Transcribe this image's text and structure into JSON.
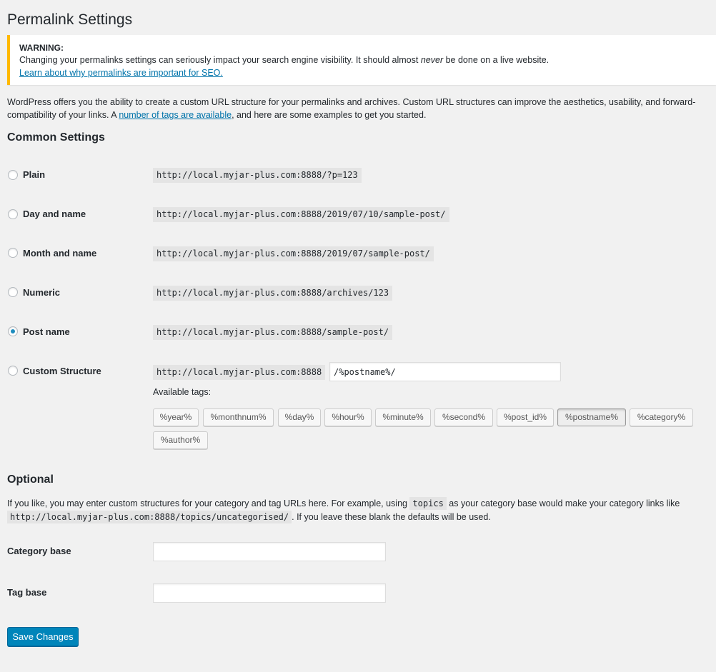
{
  "page_title": "Permalink Settings",
  "notice": {
    "heading": "WARNING:",
    "body_before": "Changing your permalinks settings can seriously impact your search engine visibility. It should almost ",
    "body_em": "never",
    "body_after": " be done on a live website.",
    "link": "Learn about why permalinks are important for SEO."
  },
  "intro": {
    "before": "WordPress offers you the ability to create a custom URL structure for your permalinks and archives. Custom URL structures can improve the aesthetics, usability, and forward-compatibility of your links. A ",
    "link": "number of tags are available",
    "after": ", and here are some examples to get you started."
  },
  "common": {
    "heading": "Common Settings",
    "options": [
      {
        "label": "Plain",
        "example": "http://local.myjar-plus.com:8888/?p=123",
        "checked": false
      },
      {
        "label": "Day and name",
        "example": "http://local.myjar-plus.com:8888/2019/07/10/sample-post/",
        "checked": false
      },
      {
        "label": "Month and name",
        "example": "http://local.myjar-plus.com:8888/2019/07/sample-post/",
        "checked": false
      },
      {
        "label": "Numeric",
        "example": "http://local.myjar-plus.com:8888/archives/123",
        "checked": false
      },
      {
        "label": "Post name",
        "example": "http://local.myjar-plus.com:8888/sample-post/",
        "checked": true
      },
      {
        "label": "Custom Structure",
        "example": "http://local.myjar-plus.com:8888",
        "checked": false
      }
    ],
    "custom_value": "/%postname%/",
    "available_tags_label": "Available tags:",
    "tags": [
      "%year%",
      "%monthnum%",
      "%day%",
      "%hour%",
      "%minute%",
      "%second%",
      "%post_id%",
      "%postname%",
      "%category%",
      "%author%"
    ],
    "active_tag": "%postname%"
  },
  "optional": {
    "heading": "Optional",
    "text_before": "If you like, you may enter custom structures for your category and tag URLs here. For example, using ",
    "code1": "topics",
    "text_middle": " as your category base would make your category links like ",
    "code2": "http://local.myjar-plus.com:8888/topics/uncategorised/",
    "text_after": ". If you leave these blank the defaults will be used.",
    "category_label": "Category base",
    "category_value": "",
    "tag_label": "Tag base",
    "tag_value": ""
  },
  "save_label": "Save Changes",
  "colors": {
    "accent": "#0085ba",
    "warning": "#ffb900",
    "link": "#0073aa",
    "radio_checked": "#1e8cbe"
  }
}
